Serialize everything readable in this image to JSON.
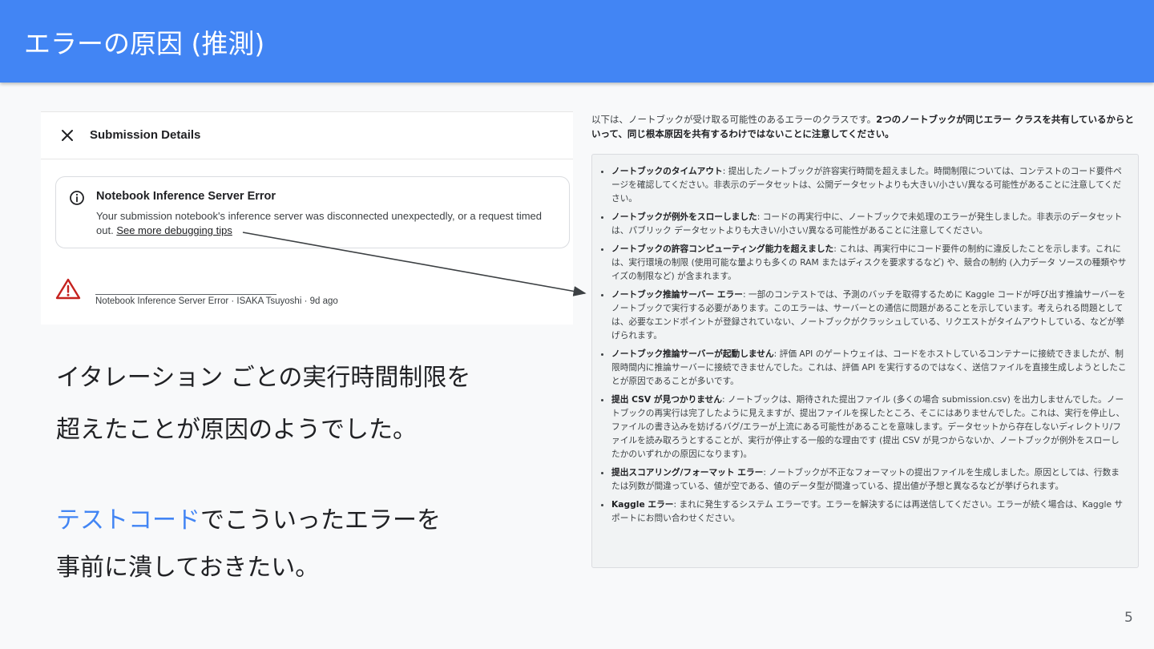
{
  "slide": {
    "title": "エラーの原因 (推測)",
    "page_number": "5"
  },
  "submission": {
    "header_title": "Submission Details",
    "error_title": "Notebook Inference Server Error",
    "error_message": "Your submission notebook's inference server was disconnected unexpectedly, or a request timed out.",
    "debug_link": "See more debugging tips",
    "meta": "Notebook Inference Server Error · ISAKA Tsuyoshi · 9d ago"
  },
  "left_text": {
    "line1": "イタレーション ごとの実行時間制限を",
    "line2": "超えたことが原因のようでした。",
    "line3_accent": "テストコード",
    "line3_rest": "でこういったエラーを",
    "line4": "事前に潰しておきたい。"
  },
  "doc": {
    "intro_normal": "以下は、ノートブックが受け取る可能性のあるエラーのクラスです。",
    "intro_bold": "2つのノートブックが同じエラー クラスを共有しているからといって、同じ根本原因を共有するわけではないことに注意してください。",
    "items": [
      {
        "term": "ノートブックのタイムアウト",
        "desc": ": 提出したノートブックが許容実行時間を超えました。時間制限については、コンテストのコード要件ページを確認してください。非表示のデータセットは、公開データセットよりも大きい/小さい/異なる可能性があることに注意してください。"
      },
      {
        "term": "ノートブックが例外をスローしました",
        "desc": ": コードの再実行中に、ノートブックで未処理のエラーが発生しました。非表示のデータセットは、パブリック データセットよりも大きい/小さい/異なる可能性があることに注意してください。"
      },
      {
        "term": "ノートブックの許容コンピューティング能力を超えました",
        "desc": ": これは、再実行中にコード要件の制約に違反したことを示します。これには、実行環境の制限 (使用可能な量よりも多くの RAM またはディスクを要求するなど) や、競合の制約 (入力データ ソースの種類やサイズの制限など) が含まれます。"
      },
      {
        "term": "ノートブック推論サーバー エラー",
        "desc": ": 一部のコンテストでは、予測のバッチを取得するために Kaggle コードが呼び出す推論サーバーをノートブックで実行する必要があります。このエラーは、サーバーとの通信に問題があることを示しています。考えられる問題としては、必要なエンドポイントが登録されていない、ノートブックがクラッシュしている、リクエストがタイムアウトしている、などが挙げられます。"
      },
      {
        "term": "ノートブック推論サーバーが起動しません",
        "desc": ": 評価 API のゲートウェイは、コードをホストしているコンテナーに接続できましたが、制限時間内に推論サーバーに接続できませんでした。これは、評価 API を実行するのではなく、送信ファイルを直接生成しようとしたことが原因であることが多いです。"
      },
      {
        "term": "提出 CSV が見つかりません",
        "desc": ": ノートブックは、期待された提出ファイル (多くの場合 submission.csv) を出力しませんでした。ノートブックの再実行は完了したように見えますが、提出ファイルを探したところ、そこにはありませんでした。これは、実行を停止し、ファイルの書き込みを妨げるバグ/エラーが上流にある可能性があることを意味します。データセットから存在しないディレクトリ/ファイルを読み取ろうとすることが、実行が停止する一般的な理由です (提出 CSV が見つからないか、ノートブックが例外をスローしたかのいずれかの原因になります)。"
      },
      {
        "term": "提出スコアリング/フォーマット エラー",
        "desc": ": ノートブックが不正なフォーマットの提出ファイルを生成しました。原因としては、行数または列数が間違っている、値が空である、値のデータ型が間違っている、提出値が予想と異なるなどが挙げられます。"
      },
      {
        "term": "Kaggle エラー",
        "desc": ": まれに発生するシステム エラーです。エラーを解決するには再送信してください。エラーが続く場合は、Kaggle サポートにお問い合わせください。"
      }
    ]
  },
  "colors": {
    "header": "#4285f4",
    "accent": "#4285f4",
    "warning": "#c5221f"
  },
  "icons": {
    "close": "close-icon",
    "info": "info-icon",
    "warning": "warning-icon",
    "arrow": "arrow-annotation"
  }
}
